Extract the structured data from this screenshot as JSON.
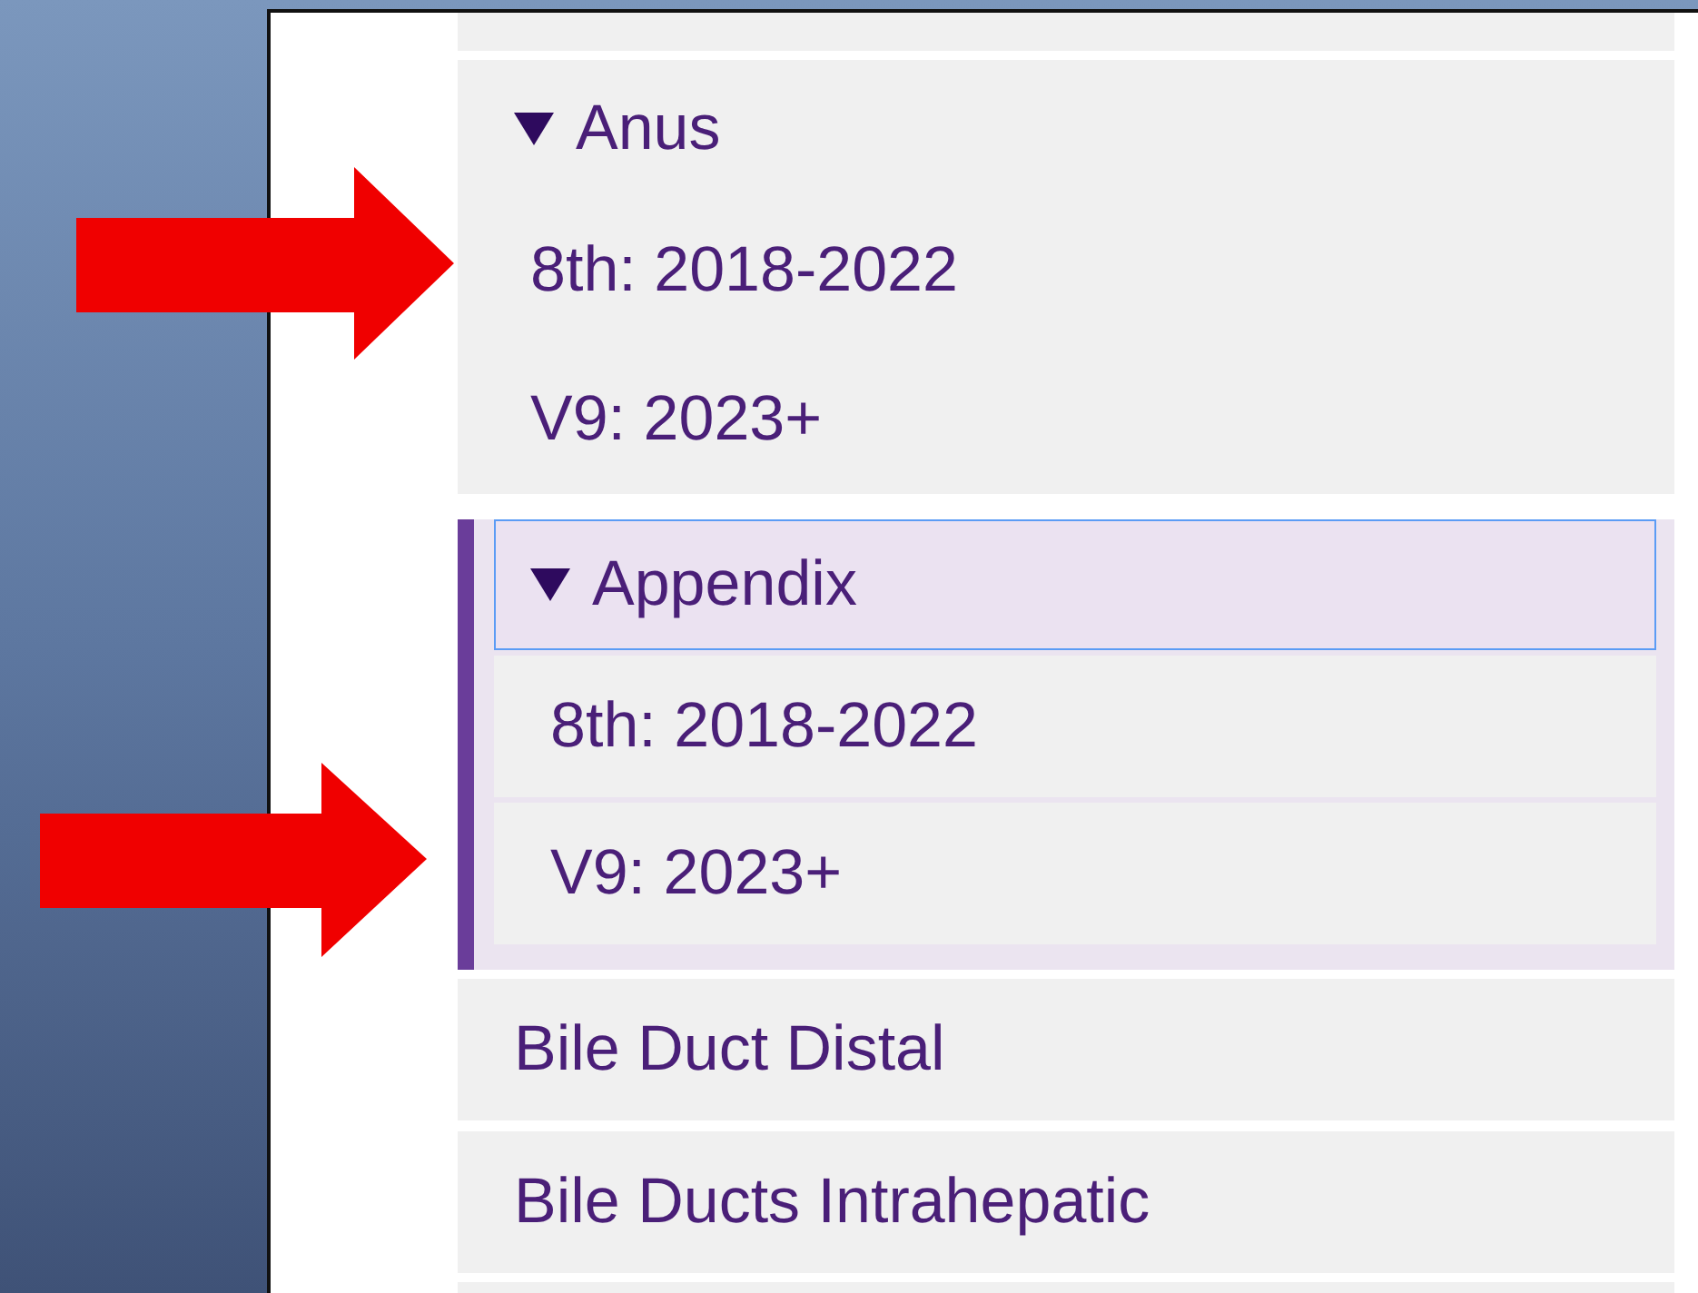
{
  "sites": [
    {
      "kind": "group",
      "label": "Anus",
      "expanded": true,
      "selected": false,
      "children": [
        {
          "label": "8th: 2018-2022"
        },
        {
          "label": "V9: 2023+"
        }
      ]
    },
    {
      "kind": "group",
      "label": "Appendix",
      "expanded": true,
      "selected": true,
      "children": [
        {
          "label": "8th: 2018-2022"
        },
        {
          "label": "V9: 2023+"
        }
      ]
    },
    {
      "kind": "item",
      "label": "Bile Duct Distal"
    },
    {
      "kind": "item",
      "label": "Bile Ducts Intrahepatic"
    }
  ]
}
